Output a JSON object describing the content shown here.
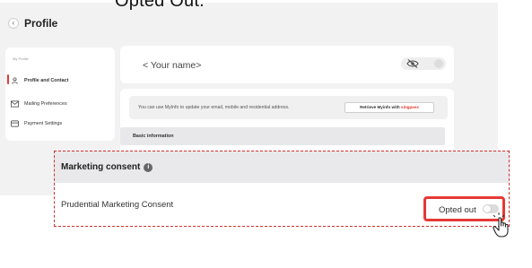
{
  "caption": "Opted Out.",
  "header": {
    "title": "Profile",
    "back_glyph": "‹"
  },
  "sidebar": {
    "section_label": "My Profile",
    "items": [
      {
        "label": "Profile and Contact",
        "icon": "person-icon",
        "active": true
      },
      {
        "label": "Mailing Preferences",
        "icon": "mail-icon",
        "active": false
      },
      {
        "label": "Payment Settings",
        "icon": "card-icon",
        "active": false
      }
    ]
  },
  "name_card": {
    "placeholder": "< Your name>"
  },
  "myinfo": {
    "text": "You can use MyInfo to update your email, mobile and residential address.",
    "button_prefix": "Retrieve Myinfo with ",
    "button_brand": "singpass"
  },
  "basic_info": {
    "label": "Basic information"
  },
  "marketing": {
    "title": "Marketing consent",
    "row_label": "Prudential Marketing Consent",
    "status": "Opted out",
    "consent_on": false
  },
  "colors": {
    "accent": "#e53935",
    "background": "#f2f2f3"
  }
}
